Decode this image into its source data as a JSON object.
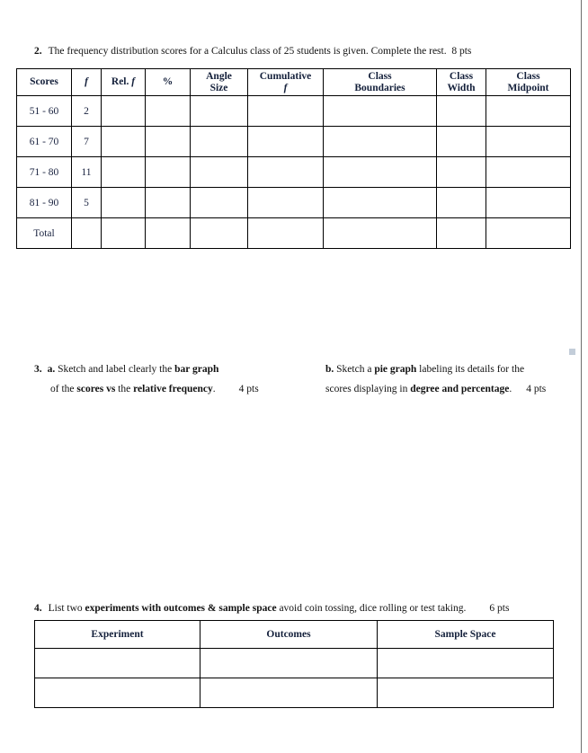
{
  "document": {
    "title": "Statistics Worksheet Page"
  },
  "questions": {
    "q2": {
      "number": "2.",
      "prompt": "The frequency distribution scores for a Calculus class of 25 students is given. Complete the rest.",
      "points": "8 pts"
    },
    "q3": {
      "number": "3.",
      "part_a": {
        "label": "a.",
        "line1_pre": "Sketch and label clearly the ",
        "line1_bold": "bar graph",
        "line2_pre": "of the ",
        "line2_bold1": "scores vs",
        "line2_mid": " the ",
        "line2_bold2": "relative frequency",
        "line2_post": ".",
        "points": "4 pts"
      },
      "part_b": {
        "label": "b.",
        "line1_pre": "Sketch a ",
        "line1_bold": "pie graph",
        "line1_post": " labeling its details for the",
        "line2_pre": "scores displaying in ",
        "line2_bold": "degree and percentage",
        "line2_post": ".",
        "points": "4 pts"
      }
    },
    "q4": {
      "number": "4.",
      "prompt_pre": "List two ",
      "prompt_bold": "experiments with outcomes & sample space",
      "prompt_post": " avoid coin tossing, dice rolling or test taking.",
      "points": "6 pts"
    }
  },
  "freq_table": {
    "headers": [
      {
        "line1": "Scores",
        "line2": ""
      },
      {
        "line1": "f",
        "line2": "",
        "italic1": true
      },
      {
        "line1": "Rel. f",
        "line2": ""
      },
      {
        "line1": "%",
        "line2": ""
      },
      {
        "line1": "Angle",
        "line2": "Size"
      },
      {
        "line1": "Cumulative",
        "line2": "f",
        "italic2": true
      },
      {
        "line1": "Class",
        "line2": "Boundaries"
      },
      {
        "line1": "Class",
        "line2": "Width"
      },
      {
        "line1": "Class",
        "line2": "Midpoint"
      }
    ],
    "header_labels": {
      "scores": "Scores",
      "f": "f",
      "rel_f_prefix": "Rel. ",
      "rel_f_italic": "f",
      "percent": "%",
      "angle_line1": "Angle",
      "angle_line2": "Size",
      "cumulative_line1": "Cumulative",
      "cumulative_line2": "f",
      "boundaries_line1": "Class",
      "boundaries_line2": "Boundaries",
      "width_line1": "Class",
      "width_line2": "Width",
      "midpoint_line1": "Class",
      "midpoint_line2": "Midpoint"
    },
    "rows": [
      {
        "scores": "51 - 60",
        "f": "2",
        "rel_f": "",
        "percent": "",
        "angle_size": "",
        "cumulative_f": "",
        "class_boundaries": "",
        "class_width": "",
        "class_midpoint": ""
      },
      {
        "scores": "61 - 70",
        "f": "7",
        "rel_f": "",
        "percent": "",
        "angle_size": "",
        "cumulative_f": "",
        "class_boundaries": "",
        "class_width": "",
        "class_midpoint": ""
      },
      {
        "scores": "71 - 80",
        "f": "11",
        "rel_f": "",
        "percent": "",
        "angle_size": "",
        "cumulative_f": "",
        "class_boundaries": "",
        "class_width": "",
        "class_midpoint": ""
      },
      {
        "scores": "81 - 90",
        "f": "5",
        "rel_f": "",
        "percent": "",
        "angle_size": "",
        "cumulative_f": "",
        "class_boundaries": "",
        "class_width": "",
        "class_midpoint": ""
      },
      {
        "scores": "Total",
        "f": "",
        "rel_f": "",
        "percent": "",
        "angle_size": "",
        "cumulative_f": "",
        "class_boundaries": "",
        "class_width": "",
        "class_midpoint": ""
      }
    ]
  },
  "experiments_table": {
    "headers": {
      "experiment": "Experiment",
      "outcomes": "Outcomes",
      "sample_space": "Sample Space"
    },
    "rows": [
      {
        "experiment": "",
        "outcomes": "",
        "sample_space": ""
      },
      {
        "experiment": "",
        "outcomes": "",
        "sample_space": ""
      }
    ]
  },
  "colors": {
    "page_background": "#ffffff",
    "text": "#16213e",
    "table_border": "#000000",
    "page_edge": "#6e6e6e"
  }
}
